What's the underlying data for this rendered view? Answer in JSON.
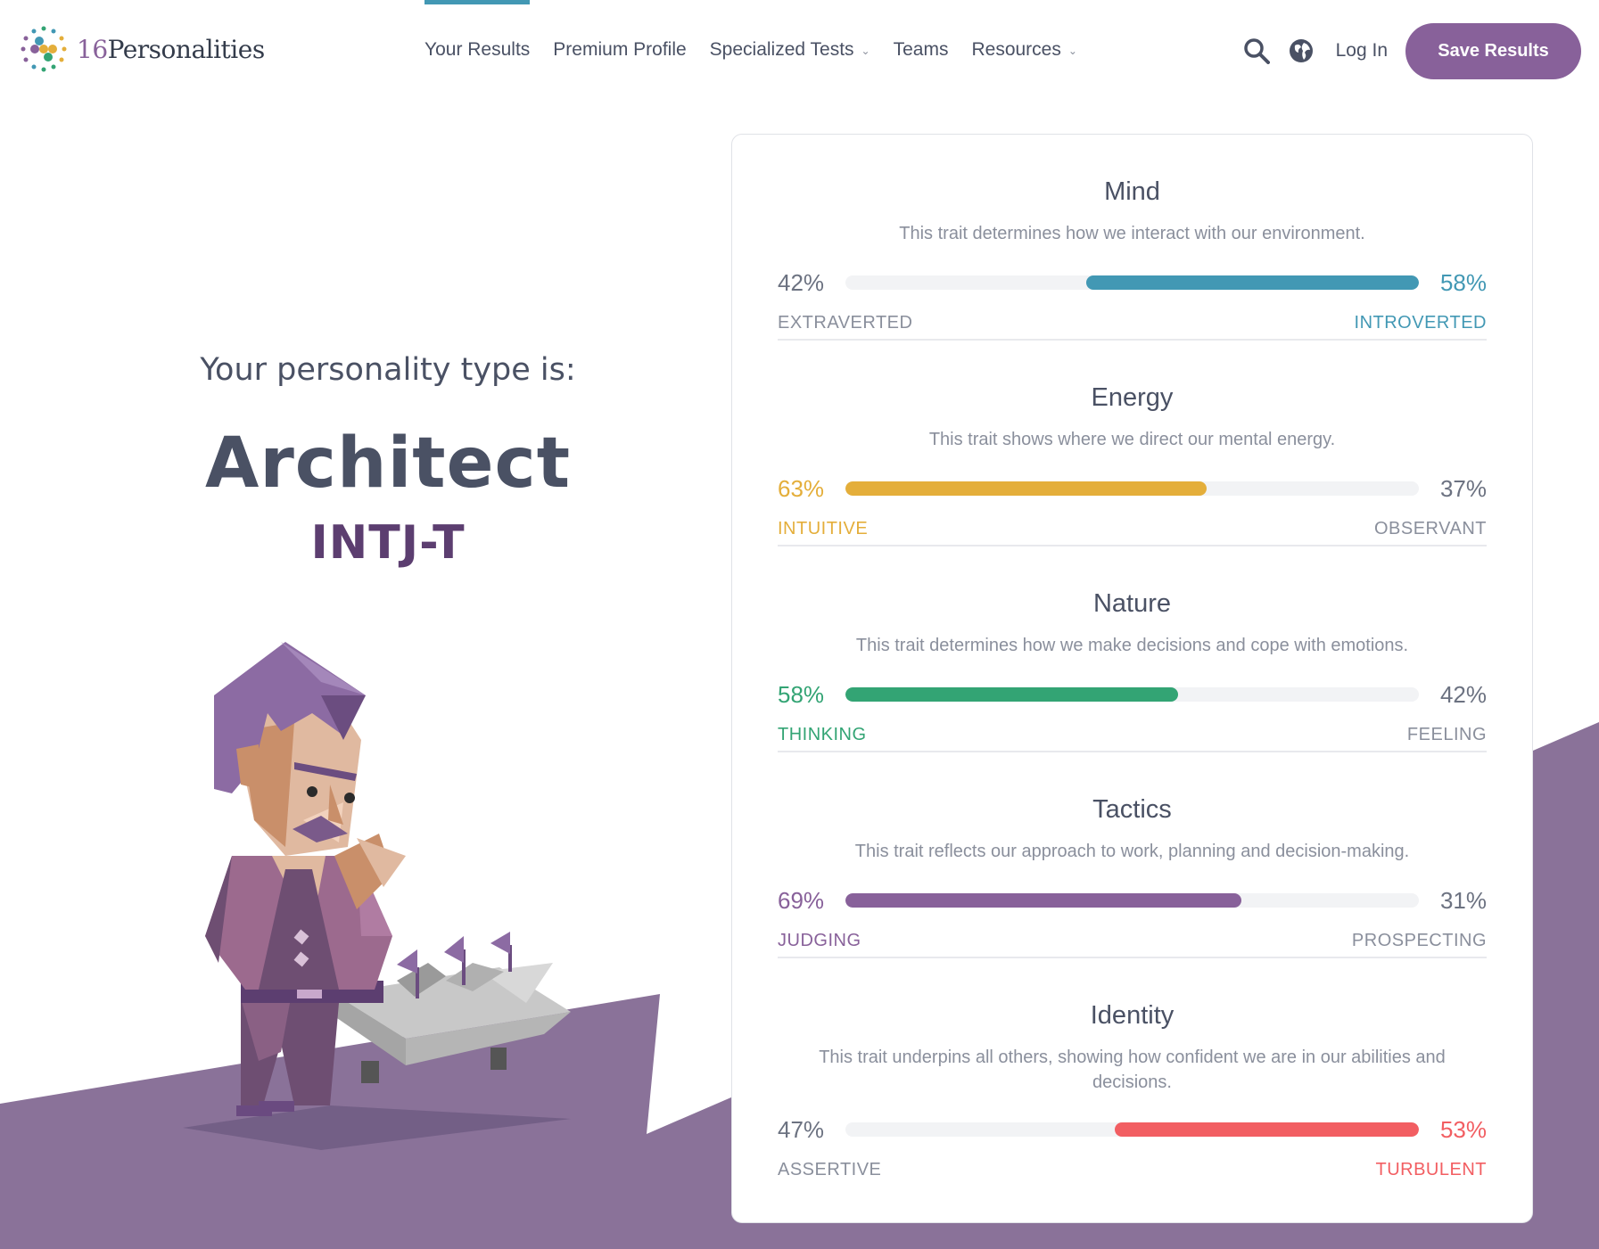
{
  "brand": {
    "name_prefix": "16",
    "name_rest": "Personalities",
    "accent_purple": "#88619a",
    "accent_blue": "#4298b4"
  },
  "nav": {
    "items": [
      {
        "label": "Your Results",
        "active": true,
        "dropdown": false
      },
      {
        "label": "Premium Profile",
        "active": false,
        "dropdown": false
      },
      {
        "label": "Specialized Tests",
        "active": false,
        "dropdown": true
      },
      {
        "label": "Teams",
        "active": false,
        "dropdown": false
      },
      {
        "label": "Resources",
        "active": false,
        "dropdown": true
      }
    ],
    "login_label": "Log In",
    "save_label": "Save Results",
    "icons": [
      "search-icon",
      "globe-icon"
    ]
  },
  "result": {
    "intro": "Your personality type is:",
    "type_name": "Architect",
    "type_code": "INTJ-T"
  },
  "traits": [
    {
      "title": "Mind",
      "description": "This trait determines how we interact with our environment.",
      "left_pct": "42%",
      "right_pct": "58%",
      "left_label": "EXTRAVERTED",
      "right_label": "INTROVERTED",
      "dominant": "right",
      "dominant_value": 0.58,
      "color": "#4298b4"
    },
    {
      "title": "Energy",
      "description": "This trait shows where we direct our mental energy.",
      "left_pct": "63%",
      "right_pct": "37%",
      "left_label": "INTUITIVE",
      "right_label": "OBSERVANT",
      "dominant": "left",
      "dominant_value": 0.63,
      "color": "#e4ae3a"
    },
    {
      "title": "Nature",
      "description": "This trait determines how we make decisions and cope with emotions.",
      "left_pct": "58%",
      "right_pct": "42%",
      "left_label": "THINKING",
      "right_label": "FEELING",
      "dominant": "left",
      "dominant_value": 0.58,
      "color": "#33a474"
    },
    {
      "title": "Tactics",
      "description": "This trait reflects our approach to work, planning and decision-making.",
      "left_pct": "69%",
      "right_pct": "31%",
      "left_label": "JUDGING",
      "right_label": "PROSPECTING",
      "dominant": "left",
      "dominant_value": 0.69,
      "color": "#88619a"
    },
    {
      "title": "Identity",
      "description": "This trait underpins all others, showing how confident we are in our abilities and decisions.",
      "left_pct": "47%",
      "right_pct": "53%",
      "left_label": "ASSERTIVE",
      "right_label": "TURBULENT",
      "dominant": "right",
      "dominant_value": 0.53,
      "color": "#f25e62"
    }
  ]
}
